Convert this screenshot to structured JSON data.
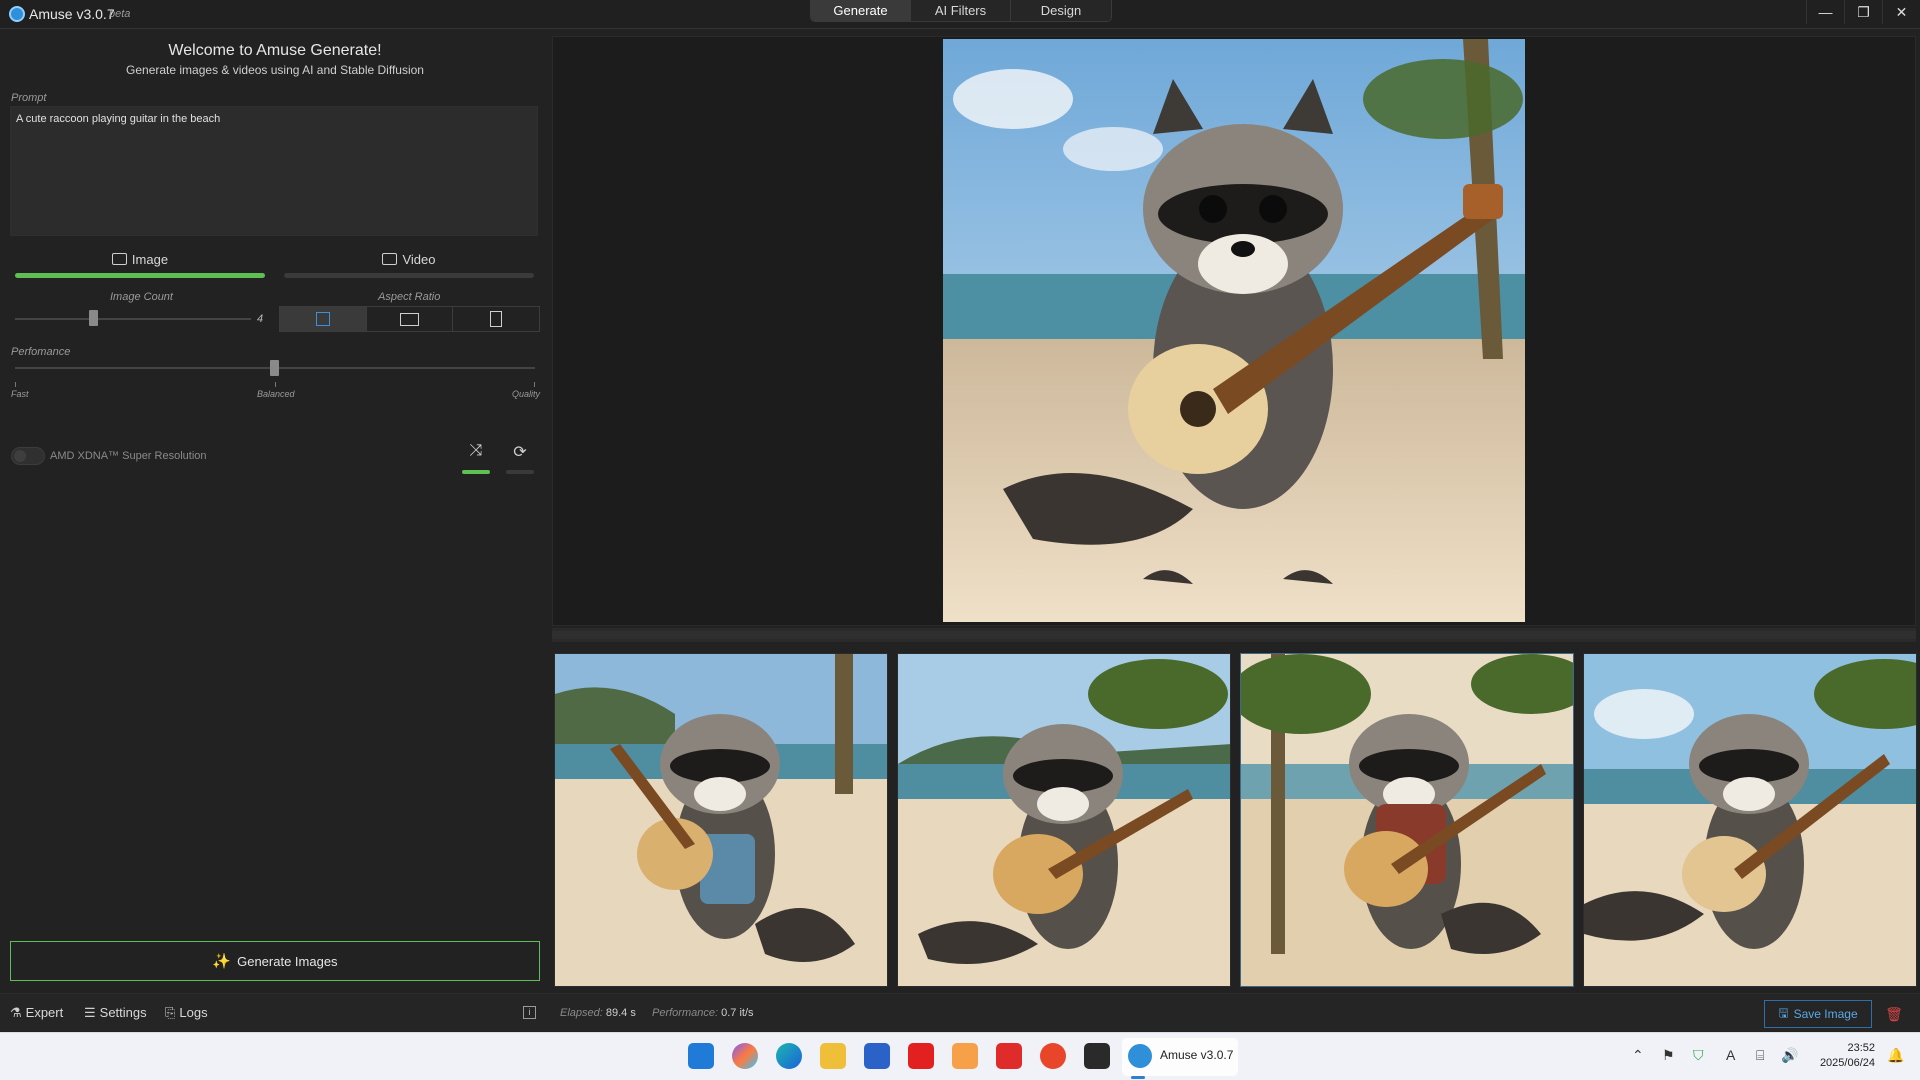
{
  "titlebar": {
    "app_name": "Amuse v3.0.7",
    "badge": "beta",
    "tabs": [
      "Generate",
      "AI Filters",
      "Design"
    ],
    "active_tab": "Generate"
  },
  "left": {
    "welcome_title": "Welcome to Amuse Generate!",
    "welcome_subtitle": "Generate images & videos using AI and Stable Diffusion",
    "prompt_label": "Prompt",
    "prompt_value": "A cute raccoon playing guitar in the beach",
    "mode_tabs": [
      {
        "label": "Image",
        "active": true
      },
      {
        "label": "Video",
        "active": false
      }
    ],
    "image_count_label": "Image Count",
    "image_count_value": "4",
    "image_count_slider_fraction": 0.33,
    "aspect_ratio_label": "Aspect Ratio",
    "aspect_options": [
      "square",
      "landscape",
      "portrait"
    ],
    "aspect_selected": "square",
    "performance_label": "Perfomance",
    "performance_marks": [
      "Fast",
      "Balanced",
      "Quality"
    ],
    "performance_value": "Balanced",
    "xdna_label": "AMD XDNA™ Super Resolution",
    "xdna_enabled": false,
    "shuffle_active": true,
    "reset_active": false,
    "generate_label": "Generate Images"
  },
  "statusbar": {
    "expert": "Expert",
    "settings": "Settings",
    "logs": "Logs",
    "elapsed_label": "Elapsed:",
    "elapsed_value": "89.4 s",
    "performance_label": "Performance:",
    "performance_value": "0.7 it/s",
    "save_label": "Save Image"
  },
  "taskbar": {
    "active_app_label": "Amuse v3.0.7",
    "time": "23:52",
    "date": "2025/06/24"
  },
  "colors": {
    "accent_green": "#5fbf55",
    "accent_blue": "#2e6fa8",
    "delete_red": "#d64545"
  }
}
